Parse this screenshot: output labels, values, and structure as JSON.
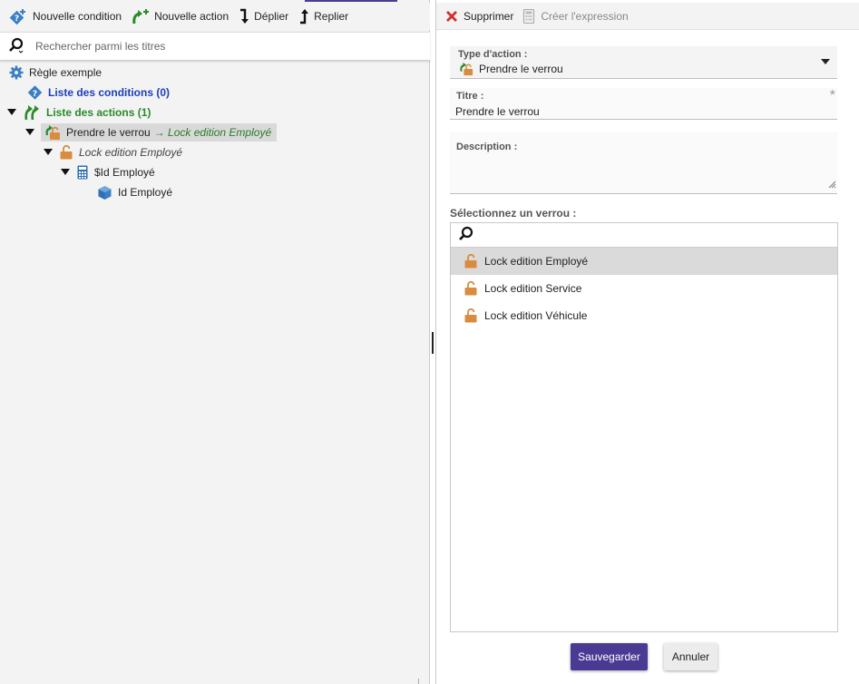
{
  "left_toolbar": {
    "new_condition": "Nouvelle condition",
    "new_action": "Nouvelle action",
    "expand": "Déplier",
    "collapse": "Replier"
  },
  "left_search": {
    "placeholder": "Rechercher parmi les titres"
  },
  "tree": {
    "root": "Règle exemple",
    "conditions": "Liste des conditions (0)",
    "actions": "Liste des actions (1)",
    "action_item": "Prendre le verrou",
    "action_target": "→ Lock edition Employé",
    "lock_node": "Lock edition Employé",
    "variable_node": "$Id Employé",
    "entity_node": "Id Employé"
  },
  "right_toolbar": {
    "delete": "Supprimer",
    "create_expression": "Créer l'expression"
  },
  "form": {
    "action_type_label": "Type d'action :",
    "action_type_value": "Prendre le verrou",
    "title_label": "Titre :",
    "title_value": "Prendre le verrou",
    "required_mark": "*",
    "description_label": "Description :",
    "lock_select_label": "Sélectionnez un verrou :",
    "locks": [
      "Lock edition Employé",
      "Lock edition Service",
      "Lock edition Véhicule"
    ],
    "selected_lock": "Lock edition Employé"
  },
  "buttons": {
    "save": "Sauvegarder",
    "cancel": "Annuler"
  },
  "colors": {
    "accent": "#4b3a93",
    "condition_blue": "#1d3fbb",
    "action_green": "#2a8a2a",
    "lock_orange": "#d98c3f",
    "delete_red": "#d0312d"
  },
  "icons": {
    "new_condition": "diamond-question-plus-icon",
    "new_action": "green-arrow-plus-icon",
    "expand": "arrow-down-icon",
    "collapse": "arrow-up-icon",
    "search": "magnifier-icon",
    "rule": "gear-icon",
    "delete": "x-icon",
    "expression": "calculator-icon",
    "lock": "lock-open-icon",
    "variable": "calculator-icon",
    "entity": "cube-icon"
  }
}
